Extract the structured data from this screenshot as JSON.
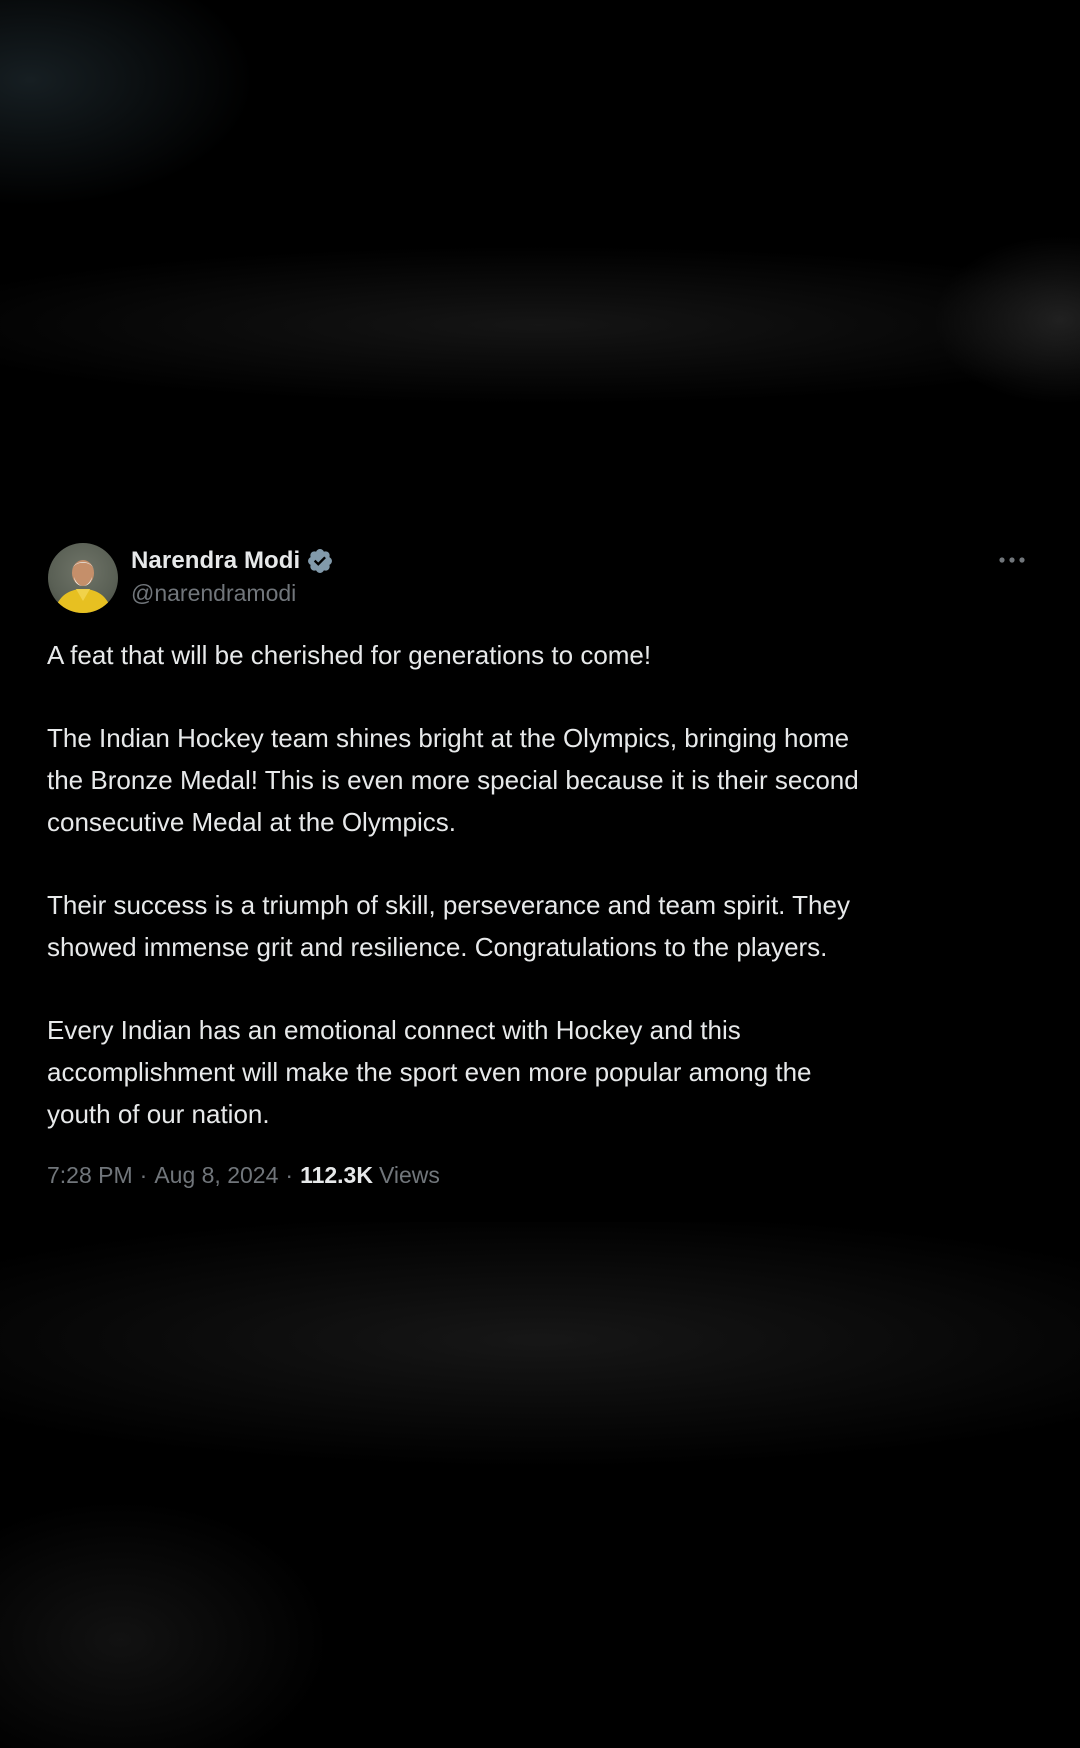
{
  "tweet": {
    "author": {
      "display_name": "Narendra Modi",
      "handle": "@narendramodi",
      "verified": true,
      "avatar_icon": "profile-photo"
    },
    "more_icon": "ellipsis-icon",
    "paragraphs": [
      "A feat that will be cherished for generations to come!",
      "The Indian Hockey team shines bright at the Olympics, bringing home\nthe Bronze Medal! This is even more special because it is their second\nconsecutive Medal at the Olympics.",
      "Their success is a triumph of skill, perseverance and team spirit. They\nshowed immense grit and resilience. Congratulations to the players.",
      "Every Indian has an emotional connect with Hockey and this\naccomplishment will make the sport even more popular among the\nyouth of our nation."
    ],
    "time": "7:28 PM",
    "separator": "·",
    "date": "Aug 8, 2024",
    "views_count": "112.3K",
    "views_label": "Views"
  },
  "colors": {
    "background": "#000000",
    "primary_text": "#e7e9ea",
    "secondary_text": "#71767b",
    "verified_badge": "#829aab"
  }
}
